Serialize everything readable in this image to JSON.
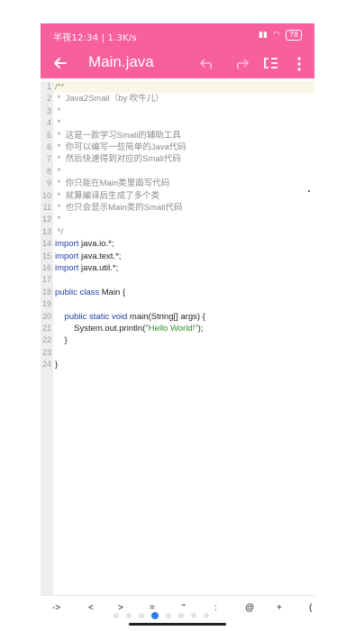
{
  "status_bar": {
    "left_text": "半夜12:34 | 1.3K/s",
    "battery": "78"
  },
  "app_bar": {
    "title": "Main.java",
    "accent": "#f75f9d"
  },
  "editor": {
    "lines": [
      {
        "n": "1",
        "parts": [
          {
            "t": "/**",
            "c": "comment"
          }
        ]
      },
      {
        "n": "2",
        "parts": [
          {
            "t": " *  Java2Smali（by 吹牛儿）",
            "c": "comment"
          }
        ]
      },
      {
        "n": "3",
        "parts": [
          {
            "t": " *",
            "c": "comment"
          }
        ]
      },
      {
        "n": "4",
        "parts": [
          {
            "t": " *",
            "c": "comment"
          }
        ]
      },
      {
        "n": "5",
        "parts": [
          {
            "t": " *  这是一款学习Smali的辅助工具",
            "c": "comment"
          }
        ]
      },
      {
        "n": "6",
        "parts": [
          {
            "t": " *  你可以编写一些简单的Java代码",
            "c": "comment"
          }
        ]
      },
      {
        "n": "7",
        "parts": [
          {
            "t": " *  然后快速得到对应的Smali代码",
            "c": "comment"
          }
        ]
      },
      {
        "n": "8",
        "parts": [
          {
            "t": " *",
            "c": "comment"
          }
        ]
      },
      {
        "n": "9",
        "parts": [
          {
            "t": " *  你只能在Main类里面写代码",
            "c": "comment"
          }
        ]
      },
      {
        "n": "10",
        "parts": [
          {
            "t": " *  就算编译后生成了多个类",
            "c": "comment"
          }
        ]
      },
      {
        "n": "11",
        "parts": [
          {
            "t": " *  也只会显示Main类的Smali代码",
            "c": "comment"
          }
        ]
      },
      {
        "n": "12",
        "parts": [
          {
            "t": " *",
            "c": "comment"
          }
        ]
      },
      {
        "n": "13",
        "parts": [
          {
            "t": " */",
            "c": "comment"
          }
        ]
      },
      {
        "n": "14",
        "parts": [
          {
            "t": "import",
            "c": "kw"
          },
          {
            "t": " java.io.*;",
            "c": "plain"
          }
        ]
      },
      {
        "n": "15",
        "parts": [
          {
            "t": "import",
            "c": "kw"
          },
          {
            "t": " java.text.*;",
            "c": "plain"
          }
        ]
      },
      {
        "n": "16",
        "parts": [
          {
            "t": "import",
            "c": "kw"
          },
          {
            "t": " java.util.*;",
            "c": "plain"
          }
        ]
      },
      {
        "n": "17",
        "parts": []
      },
      {
        "n": "18",
        "parts": [
          {
            "t": "public class",
            "c": "kw"
          },
          {
            "t": " Main {",
            "c": "plain"
          }
        ]
      },
      {
        "n": "19",
        "parts": []
      },
      {
        "n": "20",
        "parts": [
          {
            "t": "    public static void",
            "c": "kw"
          },
          {
            "t": " main(String[] args) {",
            "c": "plain"
          }
        ]
      },
      {
        "n": "21",
        "parts": [
          {
            "t": "        System.out.println(",
            "c": "plain"
          },
          {
            "t": "\"Hello World!\"",
            "c": "str"
          },
          {
            "t": ");",
            "c": "plain"
          }
        ]
      },
      {
        "n": "22",
        "parts": [
          {
            "t": "    }",
            "c": "plain"
          }
        ]
      },
      {
        "n": "23",
        "parts": []
      },
      {
        "n": "24",
        "parts": [
          {
            "t": "}",
            "c": "plain"
          }
        ]
      }
    ]
  },
  "symbols": [
    "->",
    "<",
    ">",
    "=",
    "\"",
    ":",
    "@",
    "+",
    "("
  ]
}
